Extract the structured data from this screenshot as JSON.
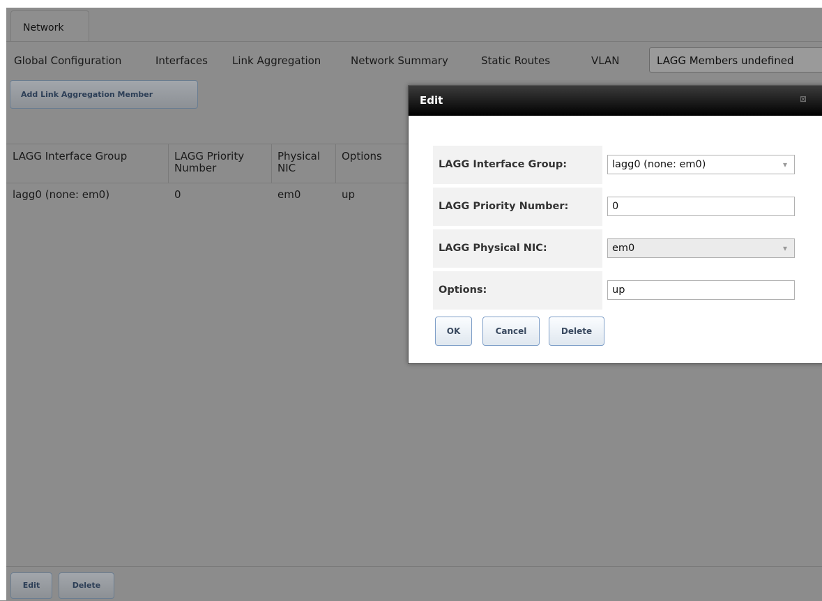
{
  "tabs": [
    {
      "label": "Network"
    }
  ],
  "subnav": {
    "items": [
      "Global Configuration",
      "Interfaces",
      "Link Aggregation",
      "Network Summary",
      "Static Routes",
      "VLAN"
    ],
    "active": "LAGG Members undefined"
  },
  "toolbar": {
    "add_label": "Add Link Aggregation Member"
  },
  "table": {
    "headers": [
      {
        "line1": "LAGG Interface Group",
        "line2": ""
      },
      {
        "line1": "LAGG Priority",
        "line2": "Number"
      },
      {
        "line1": "Physical",
        "line2": "NIC"
      },
      {
        "line1": "Options",
        "line2": ""
      }
    ],
    "rows": [
      [
        "lagg0 (none: em0)",
        "0",
        "em0",
        "up"
      ]
    ]
  },
  "bottom_bar": {
    "edit_label": "Edit",
    "delete_label": "Delete"
  },
  "dialog": {
    "title": "Edit",
    "close_glyph": "⊠",
    "fields": [
      {
        "label": "LAGG Interface Group:",
        "value": "lagg0 (none: em0)"
      },
      {
        "label": "LAGG Priority Number:",
        "value": "0"
      },
      {
        "label": "LAGG Physical NIC:",
        "value": "em0"
      },
      {
        "label": "Options:",
        "value": "up"
      }
    ],
    "buttons": {
      "ok": "OK",
      "cancel": "Cancel",
      "delete": "Delete"
    }
  }
}
